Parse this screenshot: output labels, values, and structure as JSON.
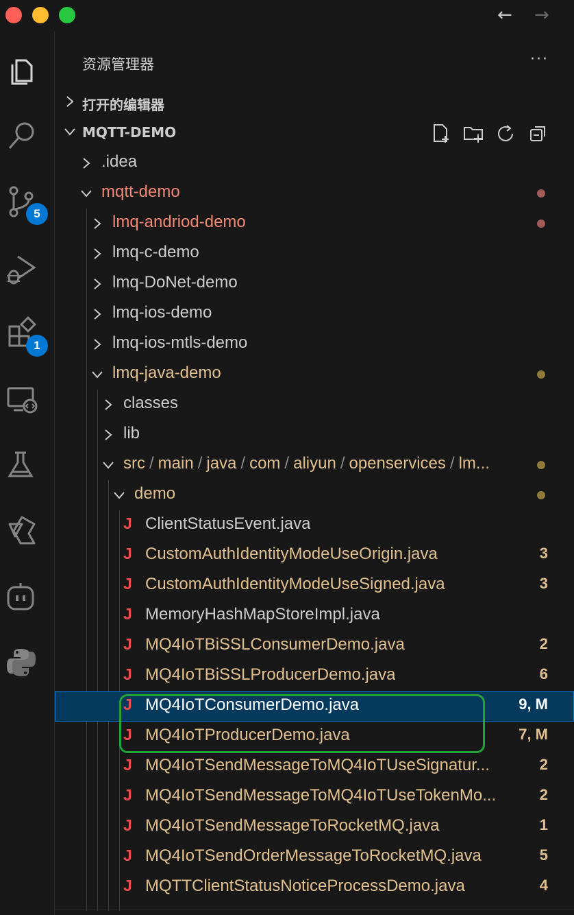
{
  "nav": {
    "back_icon": "arrow-left-icon",
    "forward_icon": "arrow-right-icon"
  },
  "activity_bar": {
    "items": [
      {
        "icon": "files-icon"
      },
      {
        "icon": "search-icon"
      },
      {
        "icon": "source-control-icon",
        "badge": "5"
      },
      {
        "icon": "run-debug-icon"
      },
      {
        "icon": "extensions-icon",
        "badge": "1"
      },
      {
        "icon": "remote-explorer-icon"
      },
      {
        "icon": "testing-icon"
      },
      {
        "icon": "tongyi-icon"
      },
      {
        "icon": "copilot-icon"
      },
      {
        "icon": "python-icon"
      }
    ]
  },
  "sidebar": {
    "title": "资源管理器",
    "more": "···",
    "open_editors_label": "打开的编辑器",
    "project_label": "MQTT-DEMO",
    "toolbar_icons": [
      "new-file-icon",
      "new-folder-icon",
      "refresh-icon",
      "collapse-all-icon"
    ]
  },
  "colors": {
    "red": "#f48771",
    "modified": "#e2c08d",
    "normal": "#cccccc",
    "dot_red": "#a15b5b",
    "dot_yellow": "#8f7b3a",
    "selection": "#04395e",
    "highlight_box": "#22a33a"
  },
  "tree": {
    "r0": {
      "name": ".idea"
    },
    "r1": {
      "name": "mqtt-demo"
    },
    "r2": {
      "name": "lmq-andriod-demo"
    },
    "r3": {
      "name": "lmq-c-demo"
    },
    "r4": {
      "name": "lmq-DoNet-demo"
    },
    "r5": {
      "name": "lmq-ios-demo"
    },
    "r6": {
      "name": "lmq-ios-mtls-demo"
    },
    "r7": {
      "name": "lmq-java-demo"
    },
    "r8": {
      "name": "classes"
    },
    "r9": {
      "name": "lib"
    },
    "r10": {
      "parts": [
        "src",
        "main",
        "java",
        "com",
        "aliyun",
        "openservices",
        "lm..."
      ],
      "sep": "/"
    },
    "r11": {
      "name": "demo"
    },
    "r12": {
      "name": "ClientStatusEvent.java"
    },
    "r13": {
      "name": "CustomAuthIdentityModeUseOrigin.java",
      "status": "3"
    },
    "r14": {
      "name": "CustomAuthIdentityModeUseSigned.java",
      "status": "3"
    },
    "r15": {
      "name": "MemoryHashMapStoreImpl.java"
    },
    "r16": {
      "name": "MQ4IoTBiSSLConsumerDemo.java",
      "status": "2"
    },
    "r17": {
      "name": "MQ4IoTBiSSLProducerDemo.java",
      "status": "6"
    },
    "r18": {
      "name": "MQ4IoTConsumerDemo.java",
      "status": "9, M"
    },
    "r19": {
      "name": "MQ4IoTProducerDemo.java",
      "status": "7, M"
    },
    "r20": {
      "name": "MQ4IoTSendMessageToMQ4IoTUseSignatur...",
      "status": "2"
    },
    "r21": {
      "name": "MQ4IoTSendMessageToMQ4IoTUseTokenMo...",
      "status": "2"
    },
    "r22": {
      "name": "MQ4IoTSendMessageToRocketMQ.java",
      "status": "1"
    },
    "r23": {
      "name": "MQ4IoTSendOrderMessageToRocketMQ.java",
      "status": "5"
    },
    "r24": {
      "name": "MQTTClientStatusNoticeProcessDemo.java",
      "status": "4"
    },
    "java_icon": "J"
  }
}
